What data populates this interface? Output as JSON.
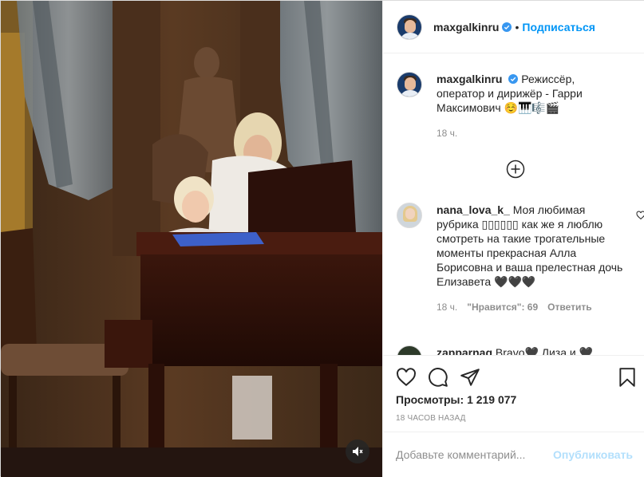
{
  "header": {
    "username": "maxgalkinru",
    "separator": "•",
    "follow_label": "Подписаться"
  },
  "caption": {
    "username": "maxgalkinru",
    "text": "Режиссёр, оператор и дирижёр - Гарри Максимович ☺️🎹🎼🎬",
    "time": "18 ч."
  },
  "comments": [
    {
      "username": "nana_lova_k_",
      "text": "Моя любимая рубрика ▯▯▯▯▯▯ как же я люблю смотреть на такие трогательные моменты прекрасная Алла Борисовна и ваша прелестная дочь Елизавета 🖤🖤🖤",
      "time": "18 ч.",
      "likes": "\"Нравится\": 69",
      "reply_label": "Ответить"
    },
    {
      "username": "zapparnag",
      "text": "Bravo🖤 Лиза и 🖤",
      "time": "",
      "likes": "",
      "reply_label": ""
    }
  ],
  "stats": {
    "views_label": "Просмотры:",
    "views_count": "1 219 077",
    "time_ago": "18 ЧАСОВ НАЗАД"
  },
  "composer": {
    "placeholder": "Добавьте комментарий...",
    "publish_label": "Опубликовать"
  },
  "colors": {
    "accent": "#0095f6",
    "publish_disabled": "#b2dffc",
    "muted_text": "#8e8e8e",
    "border": "#efefef"
  },
  "icons": [
    "verified-badge-icon",
    "load-more-plus-icon",
    "heart-icon",
    "comment-icon",
    "share-icon",
    "bookmark-icon",
    "mute-icon"
  ]
}
